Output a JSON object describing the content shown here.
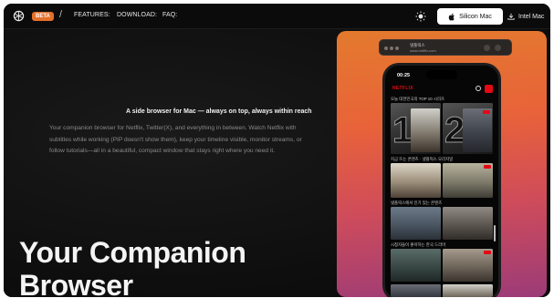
{
  "header": {
    "beta_label": "BETA",
    "separator": "/",
    "nav": {
      "features": "FEATURES:",
      "download": "DOWNLOAD:",
      "faq": "FAQ:"
    },
    "silicon_button": "Silicon Mac",
    "intel_button": "Intel Mac",
    "icons": [
      "logo-icon",
      "theme-toggle-icon",
      "apple-icon",
      "download-icon"
    ]
  },
  "hero": {
    "tagline": "A side browser for Mac — always on top, always within reach",
    "description": "Your companion browser for Netflix, Twitter(X), and everything in between. Watch Netflix with subtitles while working (PIP doesn't show them), keep your timeline visible, monitor streams, or follow tutorials—all in a beautiful, compact window that stays right where you need it.",
    "title_line1": "Your Companion",
    "title_line2": "Browser"
  },
  "preview": {
    "window_title": "넷플릭스",
    "window_url": "www.netflix.com",
    "phone_time": "00:25",
    "app_logo": "NETFLIX",
    "top_row_label": "오늘 대한민국의 TOP 10 시리즈",
    "top_numbers": [
      "1",
      "2"
    ],
    "row2_label": "지금 뜨는 콘텐츠 · 넷플릭스 오리지널",
    "row3_label": "넷플릭스에서 인기 있는 콘텐츠",
    "row4_label": "시청자들이 좋아하는 한국 드라마",
    "colors": {
      "brand_red": "#e50914",
      "beta_orange": "#e3702a",
      "promo_gradient_top": "#e47a2e",
      "promo_gradient_bottom": "#9c3b78"
    }
  }
}
